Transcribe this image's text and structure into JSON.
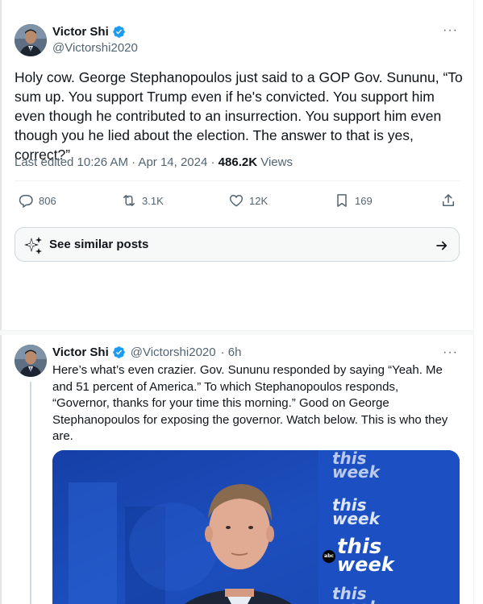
{
  "main_tweet": {
    "author_name": "Victor Shi",
    "author_handle": "@Victorshi2020",
    "more_glyph": "···",
    "text": "Holy cow. George Stephanopoulos just said to a GOP Gov. Sununu, “To sum up. You support Trump even if he's convicted. You support him even though he contributed to an insurrection. You support him even though you he lied about the election. The answer to that is yes, correct?”",
    "last_edited": "Last edited 10:26 AM · Apr 14, 2024 · ",
    "views_count": "486.2K",
    "views_label": " Views",
    "replies": "806",
    "reposts": "3.1K",
    "likes": "12K",
    "bookmarks": "169",
    "see_similar": "See similar posts"
  },
  "reply_tweet": {
    "author_name": "Victor Shi",
    "author_handle": "@Victorshi2020",
    "time": "· 6h",
    "more_glyph": "···",
    "text": "Here’s what’s even crazier. Gov. Sununu responded by saying “Yeah. Me and 51 percent of America.” To which Stephanopoulos responds, “Governor, thanks for your time this morning.” Good on George Stephanopoulos for exposing the governor. Watch below. This is who they are.",
    "video_logo_lines": [
      "this",
      "week",
      "this",
      "week",
      "abc",
      "this",
      "week",
      "this",
      "week"
    ]
  },
  "colors": {
    "verified_blue": "#1d9bf0",
    "secondary_text": "#536471",
    "primary_text": "#0f1419",
    "video_blue": "#1f54c6"
  },
  "icons": [
    "more-icon",
    "verified-badge-icon",
    "reply-icon",
    "repost-icon",
    "like-icon",
    "bookmark-icon",
    "share-icon",
    "sparkle-icon",
    "arrow-right-icon"
  ]
}
